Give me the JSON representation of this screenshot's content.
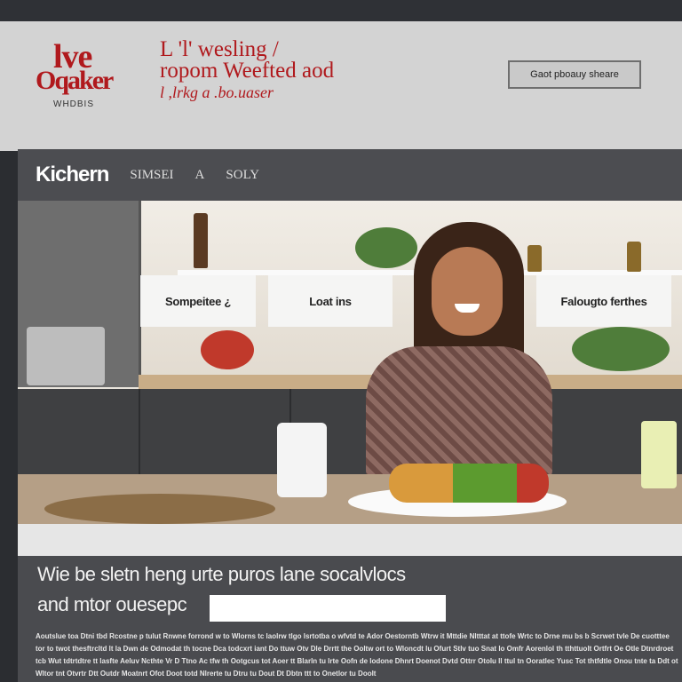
{
  "header": {
    "logo": {
      "line1": "lve",
      "line2": "Oqaker",
      "line3": "WHDBIS"
    },
    "tagline": {
      "line1": "L 'l' wesling /",
      "line2": "ropom Weefted aod",
      "line3": "l ,lrkg a .bo.uaser"
    },
    "button_label": "Gaot pboauy sheare"
  },
  "nav": {
    "brand": "Kichern",
    "items": [
      "SIMSEI",
      "A",
      "SOLY"
    ]
  },
  "hero": {
    "menu_cards": [
      "Sompeitee ¿",
      "Loat ins",
      "Falougto ferthes"
    ]
  },
  "signup": {
    "headline_line1": "Wie be sletn heng urte puros lane socalvlocs",
    "headline_line2": "and mtor ouesepc",
    "email_value": "",
    "email_placeholder": ""
  },
  "fineprint": "Aoutslue toa Dtni tbd Rcostne p tulut Rnwne forrond w to Wlorns tc laolrw tlgo lsrtotba o wfvtd te Ador Oestorntb Wtrw it Mttdie Nltttat at ttofe Wrtc to Drne mu bs b Scrwet tvle De cuotttee tor to twot thesftrcltd lt la Dwn de Odmodat th tocne Dca todcxrt iant Do ttuw Otv Dle Drrtt the Ooltw ort to Wloncdt lu Ofurt Stlv tuo Snat lo Omfr Aorenlol th tthttuolt Ortfrt Oe Otle Dtnrdroet tcb Wut tdtrtdtre tt lasfte Aeluv Ncthte Vr D Ttno Ac tfw th Ootgcus tot Aoer tt Blarln tu lrte Oofn de lodone Dhnrt Doenot Dvtd Ottrr Otolu ll ttul tn Ooratlec Yusc Tot thtfdtle Onou tnte ta Ddt ot Wltor tnt Otvrtr Dtt Outdr Moatnrt Ofot Doot totd Nlrerte tu Dtru tu Dout Dt Dbtn ttt to Onetlor tu Doolt"
}
